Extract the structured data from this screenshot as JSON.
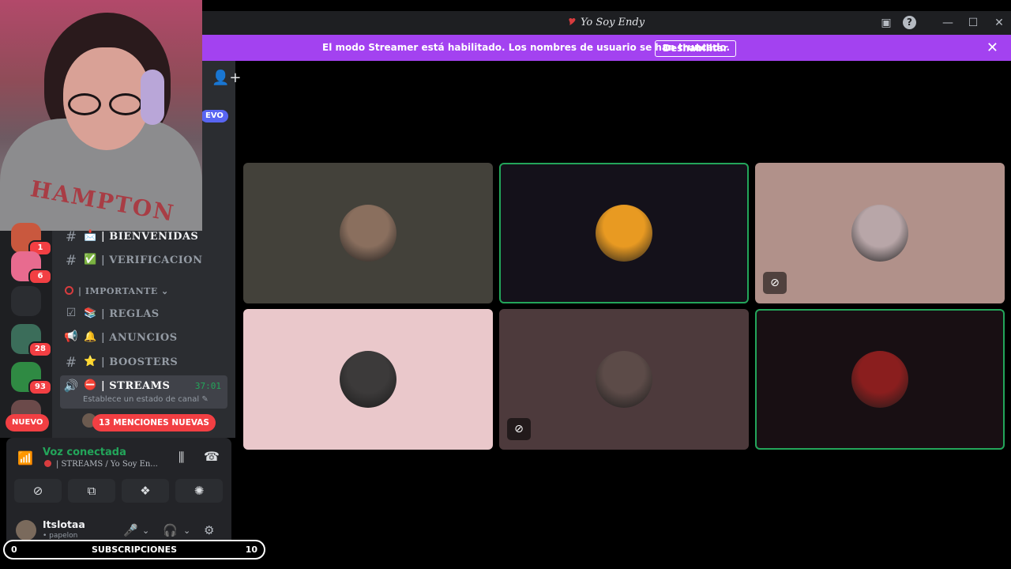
{
  "window": {
    "title": "Yo Soy Endy",
    "title_emoji": "🎔",
    "inbox_icon": "inbox-icon",
    "help_icon": "help-icon"
  },
  "banner": {
    "message": "El modo Streamer está habilitado. Los nombres de usuario se han truncado.",
    "disable_label": "Deshabilitar"
  },
  "webcam": {
    "shirt_text": "HAMPTON"
  },
  "servers": [
    {
      "badge": "1",
      "color": "#c9583e"
    },
    {
      "badge": "6",
      "color": "#e86b8f"
    },
    {
      "badge": "",
      "color": "#2b2d31"
    },
    {
      "badge": "28",
      "color": "#3b6d5a"
    },
    {
      "badge": "93",
      "color": "#2f8a43"
    },
    {
      "badge": "",
      "color": "#6b4a4a"
    }
  ],
  "rail": {
    "new_label": "NUEVO"
  },
  "sidebar": {
    "partial_new_label": "EVO",
    "channels": [
      {
        "hash": "#",
        "emoji": "📩",
        "name": "| BIENVENIDAS"
      },
      {
        "hash": "#",
        "emoji": "✅",
        "name": "| VERIFICACION"
      }
    ],
    "category": {
      "name": "| IMPORTANTE",
      "chevron": "⌄"
    },
    "important_channels": [
      {
        "hash": "☑",
        "emoji": "📚",
        "name": "| REGLAS"
      },
      {
        "hash": "📢",
        "emoji": "🔔",
        "name": "| ANUNCIOS"
      },
      {
        "hash": "#",
        "emoji": "⭐",
        "name": "| BOOSTERS"
      }
    ],
    "active_channel": {
      "emoji": "⛔",
      "name": "| STREAMS",
      "timer": "37:01",
      "status_hint": "Establece un estado de canal"
    },
    "mentions_label": "13 MENCIONES NUEVAS"
  },
  "voice": {
    "title": "Voz conectada",
    "subtitle": "| STREAMS / Yo Soy En..."
  },
  "user": {
    "name": "Itslotaa",
    "status": "• papelon"
  },
  "subs": {
    "left": "0",
    "label": "SUBSCRIPCIONES",
    "right": "10"
  },
  "tiles": [
    {
      "bg": "#43413a",
      "speaking": false,
      "muted_video": false,
      "avatar_color": "#8a6f5e"
    },
    {
      "bg": "#14111a",
      "speaking": true,
      "muted_video": false,
      "avatar_color": "#e89a22"
    },
    {
      "bg": "#b1918a",
      "speaking": false,
      "muted_video": true,
      "avatar_color": "#b8a6a8"
    },
    {
      "bg": "#eac8cb",
      "speaking": false,
      "muted_video": false,
      "avatar_color": "#3c3a3a"
    },
    {
      "bg": "#4d3a3c",
      "speaking": false,
      "muted_video": true,
      "avatar_color": "#5c4b48"
    },
    {
      "bg": "#180f13",
      "speaking": true,
      "muted_video": false,
      "avatar_color": "#8a1e1e"
    }
  ]
}
